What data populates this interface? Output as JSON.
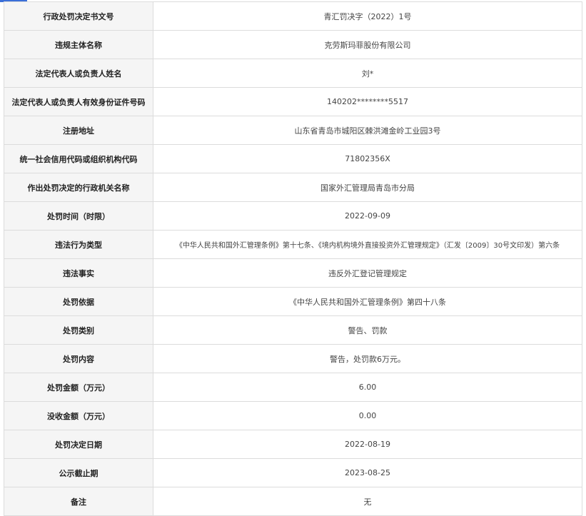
{
  "rows": [
    {
      "label": "行政处罚决定书文号",
      "value": "青汇罚决字（2022）1号"
    },
    {
      "label": "违规主体名称",
      "value": "克劳斯玛菲股份有限公司"
    },
    {
      "label": "法定代表人或负责人姓名",
      "value": "刘*"
    },
    {
      "label": "法定代表人或负责人有效身份证件号码",
      "value": "140202********5517"
    },
    {
      "label": "注册地址",
      "value": "山东省青岛市城阳区棘洪滩金岭工业园3号"
    },
    {
      "label": "统一社会信用代码或组织机构代码",
      "value": "71802356X"
    },
    {
      "label": "作出处罚决定的行政机关名称",
      "value": "国家外汇管理局青岛市分局"
    },
    {
      "label": "处罚时间（时限）",
      "value": "2022-09-09"
    },
    {
      "label": "违法行为类型",
      "value": "《中华人民共和国外汇管理条例》第十七条、《境内机构境外直接投资外汇管理规定》（汇发〔2009〕30号文印发）第六条"
    },
    {
      "label": "违法事实",
      "value": "违反外汇登记管理规定"
    },
    {
      "label": "处罚依据",
      "value": "《中华人民共和国外汇管理条例》第四十八条"
    },
    {
      "label": "处罚类别",
      "value": "警告、罚款"
    },
    {
      "label": "处罚内容",
      "value": "警告，处罚款6万元。"
    },
    {
      "label": "处罚金额（万元）",
      "value": "6.00"
    },
    {
      "label": "没收金额（万元）",
      "value": "0.00"
    },
    {
      "label": "处罚决定日期",
      "value": "2022-08-19"
    },
    {
      "label": "公示截止期",
      "value": "2023-08-25"
    },
    {
      "label": "备注",
      "value": "无"
    }
  ]
}
